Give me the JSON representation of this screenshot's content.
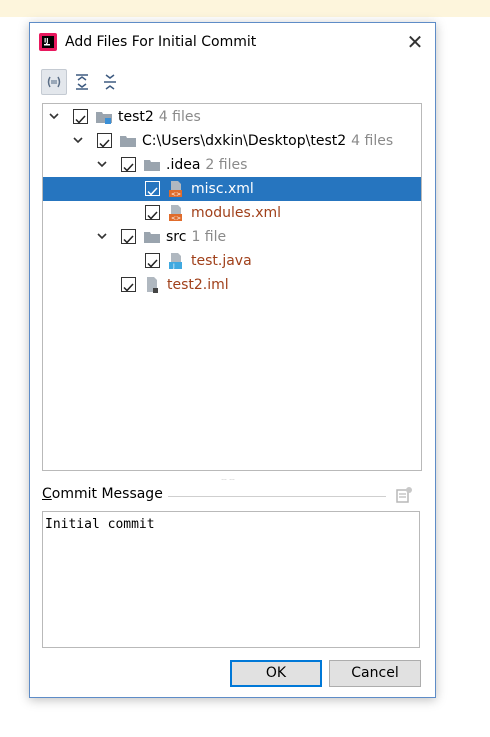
{
  "window": {
    "title": "Add Files For Initial Commit",
    "close_glyph": "✕"
  },
  "toolbar": {
    "buttons": [
      "group-by-directory-icon",
      "expand-all-icon",
      "collapse-all-icon"
    ]
  },
  "tree": {
    "rows": [
      {
        "name": "test2",
        "count": "4 files"
      },
      {
        "name": "C:\\Users\\dxkin\\Desktop\\test2",
        "count": "4 files"
      },
      {
        "name": ".idea",
        "count": "2 files"
      },
      {
        "name": "misc.xml",
        "count": ""
      },
      {
        "name": "modules.xml",
        "count": ""
      },
      {
        "name": "src",
        "count": "1 file"
      },
      {
        "name": "test.java",
        "count": ""
      },
      {
        "name": "test2.iml",
        "count": ""
      }
    ]
  },
  "commit": {
    "label_rest": "ommit Message",
    "label_mnemonic": "C",
    "message": "Initial commit"
  },
  "buttons": {
    "ok": "OK",
    "cancel": "Cancel"
  },
  "colors": {
    "selection": "#2675bf",
    "added_file": "#a0401a",
    "accent_border": "#0078d7"
  }
}
